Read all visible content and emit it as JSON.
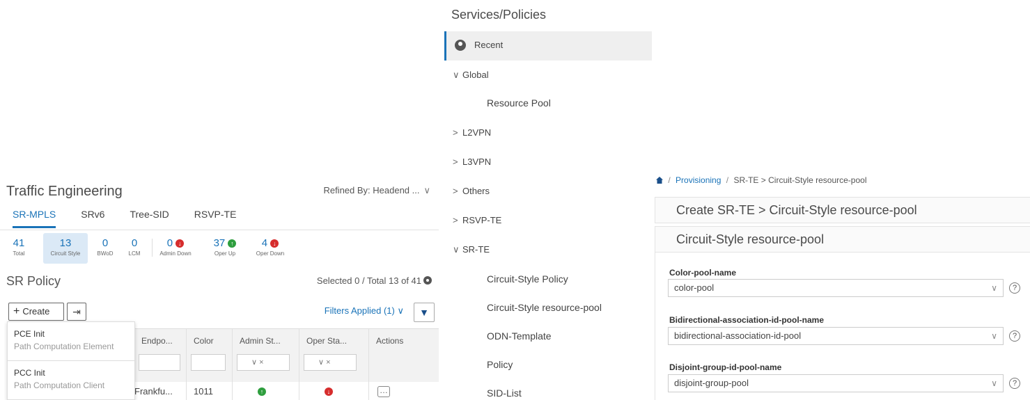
{
  "te": {
    "title": "Traffic Engineering",
    "refined": "Refined By: Headend ...",
    "tabs": [
      "SR-MPLS",
      "SRv6",
      "Tree-SID",
      "RSVP-TE"
    ],
    "stats": [
      {
        "num": "41",
        "label": "Total"
      },
      {
        "num": "13",
        "label": "Circuit Style"
      },
      {
        "num": "0",
        "label": "BWoD"
      },
      {
        "num": "0",
        "label": "LCM"
      },
      {
        "num": "0",
        "label": "Admin Down"
      },
      {
        "num": "37",
        "label": "Oper Up"
      },
      {
        "num": "4",
        "label": "Oper Down"
      }
    ],
    "policy_title": "SR Policy",
    "selected_text": "Selected 0 / Total 13 of 41",
    "create_label": "Create",
    "filters_label": "Filters Applied (1)",
    "columns": [
      "Endpo...",
      "Color",
      "Admin St...",
      "Oper Sta...",
      "Actions"
    ],
    "row": {
      "endpoint": "Frankfu...",
      "color": "1011"
    },
    "menu": [
      {
        "title": "PCE Init",
        "sub": "Path Computation Element"
      },
      {
        "title": "PCC Init",
        "sub": "Path Computation Client"
      }
    ],
    "colors": {
      "accent": "#1a73b8",
      "status_up": "#2e9e3e",
      "status_down": "#d62d2d"
    }
  },
  "services": {
    "title": "Services/Policies",
    "recent": "Recent",
    "items": [
      {
        "label": "Global",
        "caret": "∨"
      },
      {
        "label": "Resource Pool",
        "caret": ""
      },
      {
        "label": "L2VPN",
        "caret": ">"
      },
      {
        "label": "L3VPN",
        "caret": ">"
      },
      {
        "label": "Others",
        "caret": ">"
      },
      {
        "label": "RSVP-TE",
        "caret": ">"
      },
      {
        "label": "SR-TE",
        "caret": "∨"
      },
      {
        "label": "Circuit-Style Policy",
        "caret": ""
      },
      {
        "label": "Circuit-Style resource-pool",
        "caret": ""
      },
      {
        "label": "ODN-Template",
        "caret": ""
      },
      {
        "label": "Policy",
        "caret": ""
      },
      {
        "label": "SID-List",
        "caret": ""
      }
    ]
  },
  "prov": {
    "crumb_link": "Provisioning",
    "crumb_rest": "SR-TE > Circuit-Style resource-pool",
    "header": "Create SR-TE > Circuit-Style resource-pool",
    "subheader": "Circuit-Style resource-pool",
    "fields": [
      {
        "label": "Color-pool-name",
        "value": "color-pool"
      },
      {
        "label": "Bidirectional-association-id-pool-name",
        "value": "bidirectional-association-id-pool"
      },
      {
        "label": "Disjoint-group-id-pool-name",
        "value": "disjoint-group-pool"
      }
    ]
  }
}
